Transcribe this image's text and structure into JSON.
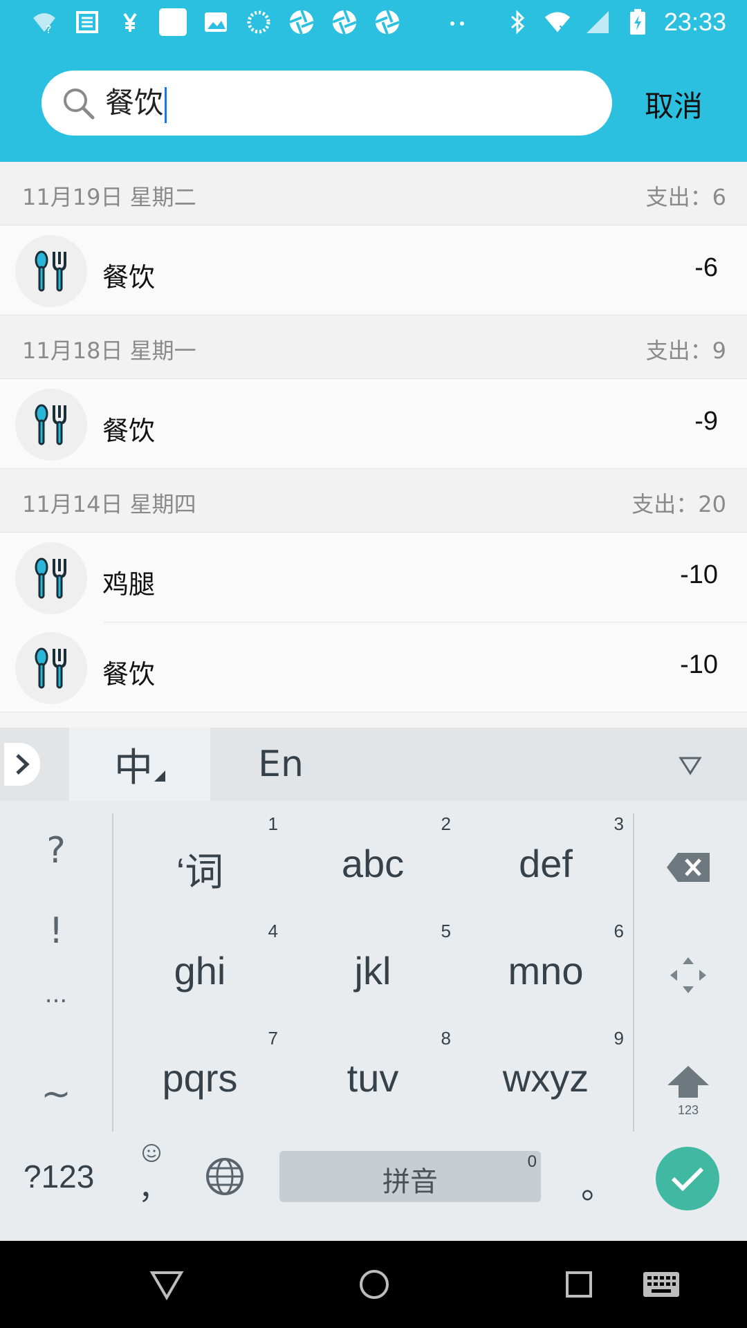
{
  "status_bar": {
    "time": "23:33",
    "left_icons": [
      "wifi-question-icon",
      "news-icon",
      "yen-icon",
      "app-square-icon",
      "image-icon",
      "loading-icon",
      "aperture-icon",
      "aperture-icon",
      "aperture-icon",
      "dots-icon"
    ],
    "right_icons": [
      "bluetooth-icon",
      "wifi-icon",
      "signal-icon",
      "battery-charging-icon"
    ]
  },
  "search": {
    "value": "餐饮",
    "cancel_label": "取消"
  },
  "records": [
    {
      "date": "11月19日  星期二",
      "expense_label": "支出：6",
      "items": [
        {
          "name": "餐饮",
          "amount": "-6",
          "icon": "utensils-icon"
        }
      ]
    },
    {
      "date": "11月18日  星期一",
      "expense_label": "支出：9",
      "items": [
        {
          "name": "餐饮",
          "amount": "-9",
          "icon": "utensils-icon"
        }
      ]
    },
    {
      "date": "11月14日  星期四",
      "expense_label": "支出：20",
      "items": [
        {
          "name": "鸡腿",
          "amount": "-10",
          "icon": "utensils-icon"
        },
        {
          "name": "餐饮",
          "amount": "-10",
          "icon": "utensils-icon"
        }
      ]
    }
  ],
  "keyboard": {
    "tab_zh": "中",
    "tab_en": "En",
    "symbols": [
      "?",
      "!",
      "...",
      "~"
    ],
    "keys": [
      {
        "num": "1",
        "label": "‘词"
      },
      {
        "num": "2",
        "label": "abc"
      },
      {
        "num": "3",
        "label": "def"
      },
      {
        "num": "4",
        "label": "ghi"
      },
      {
        "num": "5",
        "label": "jkl"
      },
      {
        "num": "6",
        "label": "mno"
      },
      {
        "num": "7",
        "label": "pqrs"
      },
      {
        "num": "8",
        "label": "tuv"
      },
      {
        "num": "9",
        "label": "wxyz"
      }
    ],
    "shift_sub": "123",
    "mode_label": "?123",
    "comma_label": "，",
    "space_label": "拼音",
    "space_num": "0",
    "period_label": "。",
    "accent_color": "#41b8a2"
  },
  "colors": {
    "header": "#2bc0e0",
    "icon_blue": "#29b6d8"
  }
}
